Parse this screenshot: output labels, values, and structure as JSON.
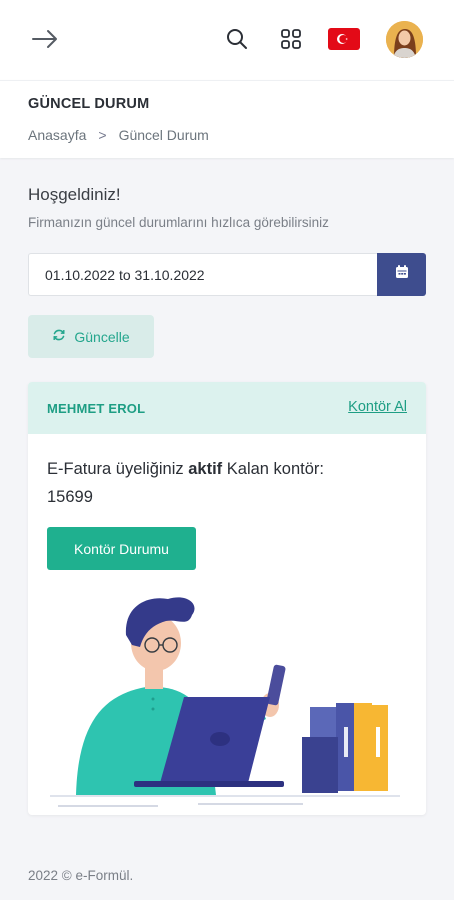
{
  "header": {
    "menu_icon": "arrow-right-icon",
    "search_icon": "search-icon",
    "apps_icon": "grid-icon",
    "language_flag": "turkey-flag-icon",
    "avatar_icon": "user-avatar"
  },
  "page": {
    "title": "GÜNCEL DURUM",
    "breadcrumb": {
      "home": "Anasayfa",
      "separator": ">",
      "current": "Güncel Durum"
    }
  },
  "welcome": {
    "title": "Hoşgeldiniz!",
    "subtitle": "Firmanızın güncel durumlarını hızlıca görebilirsiniz"
  },
  "filter": {
    "date_range": "01.10.2022 to 31.10.2022",
    "calendar_icon": "calendar-icon",
    "refresh_label": "Güncelle",
    "refresh_icon": "refresh-icon"
  },
  "card": {
    "name": "MEHMET EROL",
    "link_label": "Kontör Al",
    "status_prefix": "E-Fatura üyeliğiniz",
    "status_value": "aktif",
    "status_suffix": "Kalan kontör:",
    "remaining": "15699",
    "button_label": "Kontör Durumu"
  },
  "footer": {
    "copyright": "2022 © e-Formül."
  },
  "colors": {
    "primary": "#3e4d8e",
    "success": "#1fb08f",
    "success_light": "#dcf2ee",
    "flag_red": "#e30a17"
  }
}
